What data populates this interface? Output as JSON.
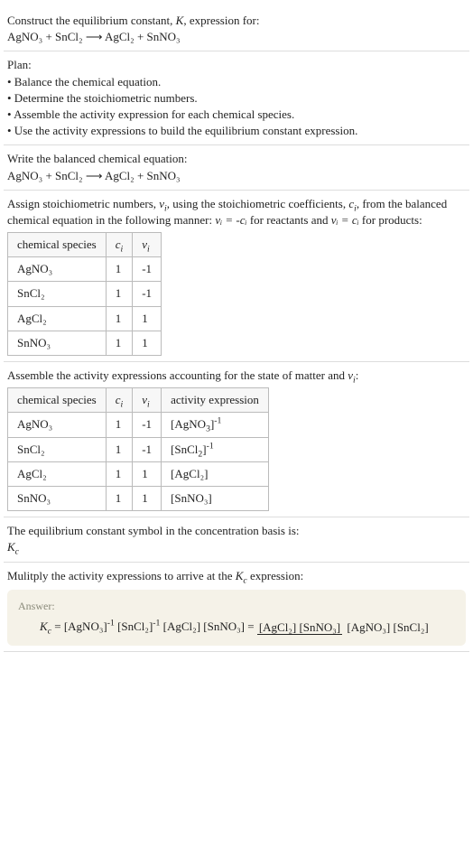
{
  "prompt": {
    "line1_a": "Construct the equilibrium constant, ",
    "line1_b": ", expression for:",
    "equation": "AgNO₃ + SnCl₂ ⟶ AgCl₂ + SnNO₃"
  },
  "plan": {
    "heading": "Plan:",
    "bullet1": "• Balance the chemical equation.",
    "bullet2": "• Determine the stoichiometric numbers.",
    "bullet3": "• Assemble the activity expression for each chemical species.",
    "bullet4": "• Use the activity expressions to build the equilibrium constant expression."
  },
  "balanced": {
    "heading": "Write the balanced chemical equation:",
    "equation": "AgNO₃ + SnCl₂ ⟶ AgCl₂ + SnNO₃"
  },
  "stoich": {
    "intro_a": "Assign stoichiometric numbers, ",
    "intro_b": ", using the stoichiometric coefficients, ",
    "intro_c": ", from the balanced chemical equation in the following manner: ",
    "intro_d": " for reactants and ",
    "intro_e": " for products:",
    "nu_eq_neg_c": "νᵢ = -cᵢ",
    "nu_eq_c": "νᵢ = cᵢ",
    "header_species": "chemical species",
    "header_c": "cᵢ",
    "header_nu": "νᵢ",
    "rows": [
      {
        "species": "AgNO₃",
        "c": "1",
        "nu": "-1"
      },
      {
        "species": "SnCl₂",
        "c": "1",
        "nu": "-1"
      },
      {
        "species": "AgCl₂",
        "c": "1",
        "nu": "1"
      },
      {
        "species": "SnNO₃",
        "c": "1",
        "nu": "1"
      }
    ]
  },
  "activity": {
    "heading_a": "Assemble the activity expressions accounting for the state of matter and ",
    "heading_b": ":",
    "header_species": "chemical species",
    "header_c": "cᵢ",
    "header_nu": "νᵢ",
    "header_act": "activity expression",
    "rows": [
      {
        "species": "AgNO₃",
        "c": "1",
        "nu": "-1",
        "act": "[AgNO₃]⁻¹"
      },
      {
        "species": "SnCl₂",
        "c": "1",
        "nu": "-1",
        "act": "[SnCl₂]⁻¹"
      },
      {
        "species": "AgCl₂",
        "c": "1",
        "nu": "1",
        "act": "[AgCl₂]"
      },
      {
        "species": "SnNO₃",
        "c": "1",
        "nu": "1",
        "act": "[SnNO₃]"
      }
    ]
  },
  "symbol": {
    "line1": "The equilibrium constant symbol in the concentration basis is:",
    "kc": "K",
    "kc_sub": "c"
  },
  "multiply": {
    "heading_a": "Mulitply the activity expressions to arrive at the ",
    "heading_b": " expression:"
  },
  "answer": {
    "label": "Answer:",
    "lhs_k": "K",
    "lhs_c": "c",
    "eq": " = ",
    "term1_base": "[AgNO₃]",
    "term1_exp": "-1",
    "term2_base": "[SnCl₂]",
    "term2_exp": "-1",
    "term3": "[AgCl₂]",
    "term4": "[SnNO₃]",
    "frac_num": "[AgCl₂] [SnNO₃]",
    "frac_den": "[AgNO₃] [SnCl₂]"
  },
  "chart_data": {
    "type": "table",
    "tables": [
      {
        "title": "Stoichiometric numbers",
        "columns": [
          "chemical species",
          "cᵢ",
          "νᵢ"
        ],
        "rows": [
          [
            "AgNO₃",
            1,
            -1
          ],
          [
            "SnCl₂",
            1,
            -1
          ],
          [
            "AgCl₂",
            1,
            1
          ],
          [
            "SnNO₃",
            1,
            1
          ]
        ]
      },
      {
        "title": "Activity expressions",
        "columns": [
          "chemical species",
          "cᵢ",
          "νᵢ",
          "activity expression"
        ],
        "rows": [
          [
            "AgNO₃",
            1,
            -1,
            "[AgNO₃]⁻¹"
          ],
          [
            "SnCl₂",
            1,
            -1,
            "[SnCl₂]⁻¹"
          ],
          [
            "AgCl₂",
            1,
            1,
            "[AgCl₂]"
          ],
          [
            "SnNO₃",
            1,
            1,
            "[SnNO₃]"
          ]
        ]
      }
    ]
  }
}
